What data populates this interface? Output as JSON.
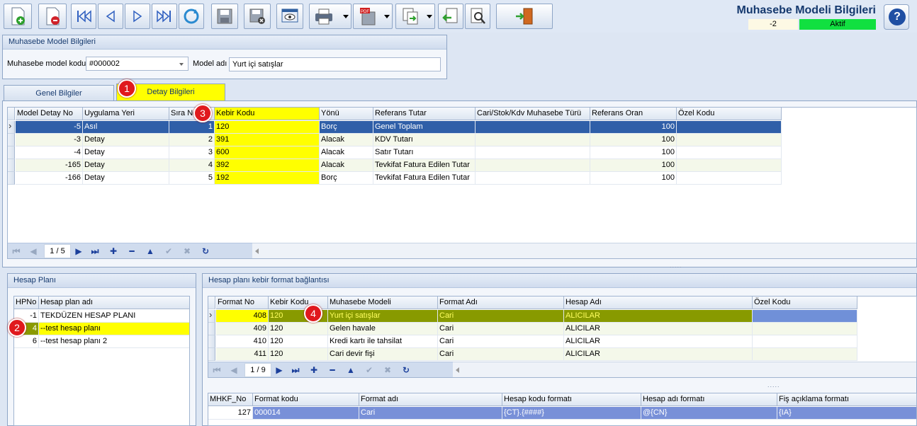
{
  "window": {
    "title": "Muhasebe Modeli Bilgileri",
    "status_code": "-2",
    "status_state": "Aktif",
    "help_label": "?"
  },
  "header_group": {
    "title": "Muhasebe Model Bilgileri",
    "code_label": "Muhasebe model kodu",
    "code_value": "#000002",
    "name_label": "Model adı",
    "name_value": "Yurt içi satışlar"
  },
  "tabs": [
    {
      "label": "Genel Bilgiler",
      "active": false
    },
    {
      "label": "Detay Bilgileri",
      "active": true
    }
  ],
  "badges": [
    "1",
    "2",
    "3",
    "4"
  ],
  "detail_grid": {
    "columns": [
      "Model Detay No",
      "Uygulama Yeri",
      "Sıra No",
      "Kebir Kodu",
      "Yönü",
      "Referans Tutar",
      "Cari/Stok/Kdv Muhasebe Türü",
      "Referans Oran",
      "Özel Kodu"
    ],
    "rows": [
      [
        "-5",
        "Asıl",
        "1",
        "120",
        "Borç",
        "Genel Toplam",
        "",
        "100",
        ""
      ],
      [
        "-3",
        "Detay",
        "2",
        "391",
        "Alacak",
        "KDV Tutarı",
        "",
        "100",
        ""
      ],
      [
        "-4",
        "Detay",
        "3",
        "600",
        "Alacak",
        "Satır Tutarı",
        "",
        "100",
        ""
      ],
      [
        "-165",
        "Detay",
        "4",
        "392",
        "Alacak",
        "Tevkifat Fatura Edilen Tutar",
        "",
        "100",
        ""
      ],
      [
        "-166",
        "Detay",
        "5",
        "192",
        "Borç",
        "Tevkifat Fatura Edilen Tutar",
        "",
        "100",
        ""
      ]
    ],
    "page": "1 / 5"
  },
  "account_plan": {
    "title": "Hesap Planı",
    "columns": [
      "HPNo",
      "Hesap plan adı"
    ],
    "rows": [
      [
        "-1",
        "TEKDÜZEN HESAP PLANI"
      ],
      [
        "4",
        "--test hesap planı"
      ],
      [
        "6",
        "--test hesap planı 2"
      ]
    ]
  },
  "format_link": {
    "title": "Hesap planı kebir format bağlantısı",
    "columns": [
      "Format No",
      "Kebir Kodu",
      "Muhasebe Modeli",
      "Format Adı",
      "Hesap Adı",
      "Özel Kodu"
    ],
    "rows": [
      [
        "408",
        "120",
        "Yurt içi satışlar",
        "Cari",
        "ALICILAR",
        ""
      ],
      [
        "409",
        "120",
        "Gelen havale",
        "Cari",
        "ALICILAR",
        ""
      ],
      [
        "410",
        "120",
        "Kredi kartı ile tahsilat",
        "Cari",
        "ALICILAR",
        ""
      ],
      [
        "411",
        "120",
        "Cari devir fişi",
        "Cari",
        "ALICILAR",
        ""
      ]
    ],
    "page": "1 / 9"
  },
  "format_detail": {
    "columns": [
      "MHKF_No",
      "Format kodu",
      "Format adı",
      "Hesap kodu formatı",
      "Hesap adı formatı",
      "Fiş açıklama formatı"
    ],
    "rows": [
      [
        "127",
        "000014",
        "Cari",
        "{CT}.{####}",
        "@{CN}",
        "{IA}"
      ]
    ]
  },
  "splitter_glyph": "....."
}
